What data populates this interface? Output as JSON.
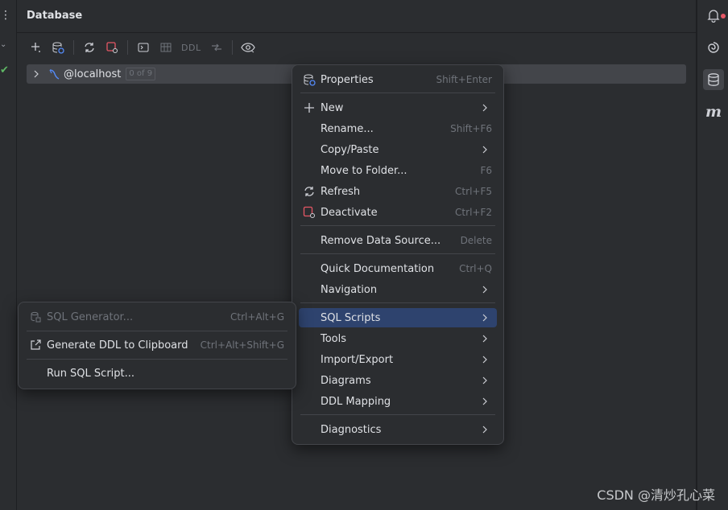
{
  "panel": {
    "title": "Database"
  },
  "toolbar": {
    "ddl_label": "DDL"
  },
  "tree": {
    "node_name": "@localhost",
    "node_count": "0 of 9"
  },
  "context_menu": {
    "properties": {
      "label": "Properties",
      "shortcut": "Shift+Enter"
    },
    "new": {
      "label": "New"
    },
    "rename": {
      "label": "Rename...",
      "shortcut": "Shift+F6"
    },
    "copy_paste": {
      "label": "Copy/Paste"
    },
    "move_to_folder": {
      "label": "Move to Folder...",
      "shortcut": "F6"
    },
    "refresh": {
      "label": "Refresh",
      "shortcut": "Ctrl+F5"
    },
    "deactivate": {
      "label": "Deactivate",
      "shortcut": "Ctrl+F2"
    },
    "remove_data_source": {
      "label": "Remove Data Source...",
      "shortcut": "Delete"
    },
    "quick_documentation": {
      "label": "Quick Documentation",
      "shortcut": "Ctrl+Q"
    },
    "navigation": {
      "label": "Navigation"
    },
    "sql_scripts": {
      "label": "SQL Scripts"
    },
    "tools": {
      "label": "Tools"
    },
    "import_export": {
      "label": "Import/Export"
    },
    "diagrams": {
      "label": "Diagrams"
    },
    "ddl_mapping": {
      "label": "DDL Mapping"
    },
    "diagnostics": {
      "label": "Diagnostics"
    }
  },
  "submenu": {
    "sql_generator": {
      "label": "SQL Generator...",
      "shortcut": "Ctrl+Alt+G"
    },
    "generate_ddl": {
      "label": "Generate DDL to Clipboard",
      "shortcut": "Ctrl+Alt+Shift+G"
    },
    "run_sql_script": {
      "label": "Run SQL Script..."
    }
  },
  "watermark": "CSDN @清炒孔心菜",
  "colors": {
    "background": "#2b2d30",
    "selection": "#2e436e",
    "accent_blue": "#548af7",
    "deactivate_red": "#e55765"
  }
}
